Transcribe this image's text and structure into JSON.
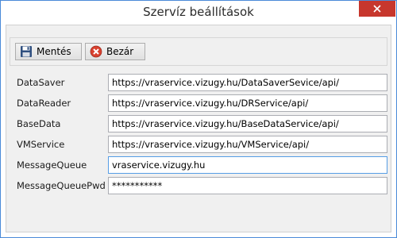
{
  "window": {
    "title": "Szervíz beállítások"
  },
  "toolbar": {
    "save_label": "Mentés",
    "close_label": "Bezár"
  },
  "settings": [
    {
      "label": "DataSaver",
      "value": "https://vraservice.vizugy.hu/DataSaverSevice/api/"
    },
    {
      "label": "DataReader",
      "value": "https://vraservice.vizugy.hu/DRService/api/"
    },
    {
      "label": "BaseData",
      "value": "https://vraservice.vizugy.hu/BaseDataService/api/"
    },
    {
      "label": "VMService",
      "value": "https://vraservice.vizugy.hu/VMService/api/"
    },
    {
      "label": "MessageQueue",
      "value": "vraservice.vizugy.hu"
    },
    {
      "label": "MessageQueuePwd",
      "value": "***********"
    }
  ],
  "colors": {
    "close_button_bg": "#c7372d",
    "window_border": "#4a8ad8",
    "focus_border": "#569de5"
  }
}
